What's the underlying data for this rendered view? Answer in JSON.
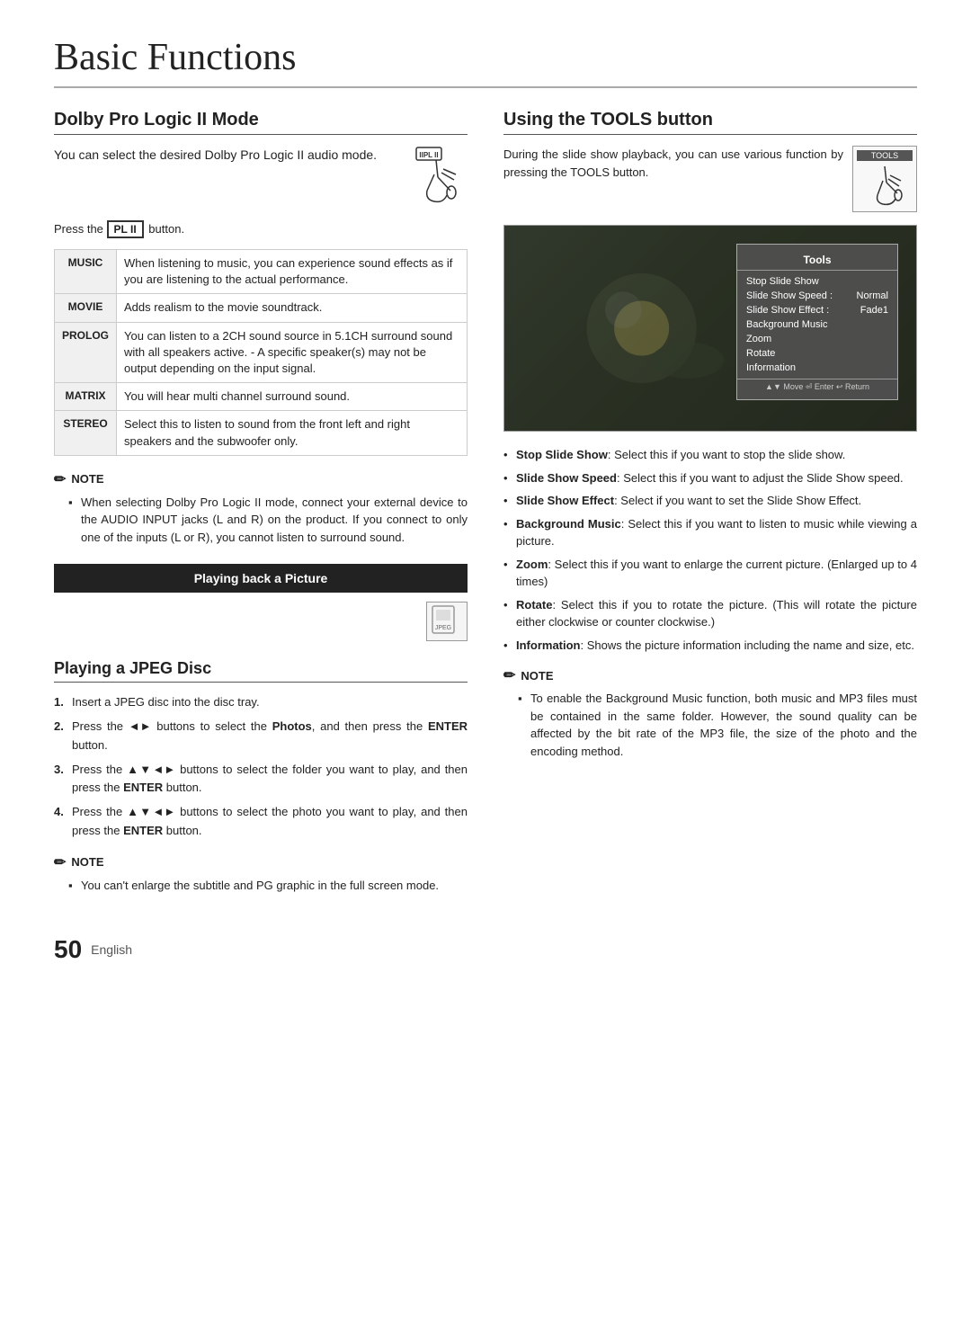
{
  "page": {
    "title": "Basic Functions",
    "number": "50",
    "language": "English"
  },
  "dolby_section": {
    "title": "Dolby Pro Logic II Mode",
    "intro": "You can select the desired Dolby Pro Logic II audio mode.",
    "press_line": "Press the",
    "press_btn": "PL II",
    "press_end": "button.",
    "modes": [
      {
        "label": "MUSIC",
        "description": "When listening to music, you can experience sound effects as if you are listening to the actual performance."
      },
      {
        "label": "MOVIE",
        "description": "Adds realism to the movie soundtrack."
      },
      {
        "label": "PROLOG",
        "description": "You can listen to a 2CH sound source in 5.1CH surround sound with all speakers active. - A specific speaker(s) may not be output depending on the input signal."
      },
      {
        "label": "MATRIX",
        "description": "You will hear multi channel surround sound."
      },
      {
        "label": "STEREO",
        "description": "Select this to listen to sound from the front left and right speakers and the subwoofer only."
      }
    ],
    "note_header": "NOTE",
    "note_body": "When selecting Dolby Pro Logic II mode, connect your external device to the AUDIO INPUT jacks (L and R) on the product. If you connect to only one of the inputs (L or R), you cannot listen to surround sound."
  },
  "playing_back": {
    "banner": "Playing back a Picture"
  },
  "jpeg_section": {
    "title": "Playing a JPEG Disc",
    "steps": [
      "Insert a JPEG disc into the disc tray.",
      "Press the ◄► buttons to select the Photos, and then press the ENTER button.",
      "Press the ▲▼◄► buttons to select the folder you want to play, and then press the ENTER button.",
      "Press the ▲▼◄► buttons to select the photo you want to play, and then press the ENTER button."
    ],
    "note_header": "NOTE",
    "note_body": "You can't enlarge the subtitle and PG graphic in the full screen mode."
  },
  "tools_section": {
    "title": "Using the TOOLS button",
    "intro": "During the slide show playback, you can use various function by pressing the TOOLS button.",
    "tools_label": "TOOLS",
    "menu": {
      "title": "Tools",
      "items": [
        {
          "label": "Stop Slide Show",
          "value": ""
        },
        {
          "label": "Slide Show Speed :",
          "value": "Normal"
        },
        {
          "label": "Slide Show Effect :",
          "value": "Fade1"
        },
        {
          "label": "Background Music",
          "value": ""
        },
        {
          "label": "Zoom",
          "value": ""
        },
        {
          "label": "Rotate",
          "value": ""
        },
        {
          "label": "Information",
          "value": ""
        }
      ],
      "footer": "▲▼ Move  ⏎ Enter  ↩ Return"
    },
    "bullets": [
      {
        "term": "Stop Slide Show",
        "desc": ": Select this if you want to stop the slide show."
      },
      {
        "term": "Slide Show Speed",
        "desc": ": Select this if you want to adjust the Slide Show speed."
      },
      {
        "term": "Slide Show Effect",
        "desc": ": Select if you want to set the Slide Show Effect."
      },
      {
        "term": "Background Music",
        "desc": ": Select this if you want to listen to music while viewing a picture."
      },
      {
        "term": "Zoom",
        "desc": ": Select this if you want to enlarge the current picture. (Enlarged up to 4 times)"
      },
      {
        "term": "Rotate",
        "desc": ": Select this if you to rotate the picture. (This will rotate the picture either clockwise or counter clockwise.)"
      },
      {
        "term": "Information",
        "desc": ": Shows the picture information including the name and size, etc."
      }
    ],
    "note_header": "NOTE",
    "note_body": "To enable the Background Music function, both music and MP3 files must be contained in the same folder. However, the sound quality can be affected by the bit rate of the MP3 file, the size of the photo and the encoding method."
  }
}
